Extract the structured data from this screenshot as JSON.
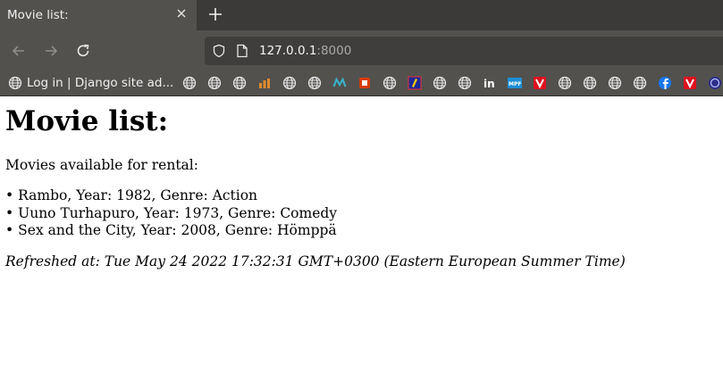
{
  "tab": {
    "title": "Movie list:"
  },
  "url": {
    "host": "127.0.0.1",
    "port": ":8000"
  },
  "bookmarks": {
    "first_label": "Log in | Django site ad...",
    "icons": [
      "globe-icon",
      "globe-icon",
      "globe-icon",
      "bars-icon",
      "globe-icon",
      "globe-icon",
      "m-logo-icon",
      "office-icon",
      "globe-icon",
      "blue-square-icon",
      "globe-icon",
      "globe-icon",
      "linkedin-icon",
      "mpf-icon",
      "v-red-icon",
      "globe-icon",
      "globe-icon",
      "globe-icon",
      "globe-icon",
      "facebook-icon",
      "v-red-icon",
      "circle-logo-icon",
      "partial-icon"
    ]
  },
  "page": {
    "title": "Movie list:",
    "intro": "Movies available for rental:",
    "movies": [
      "Rambo, Year: 1982, Genre: Action",
      "Uuno Turhapuro, Year: 1973, Genre: Comedy",
      "Sex and the City, Year: 2008, Genre: Hömppä"
    ],
    "refreshed": "Refreshed at: Tue May 24 2022 17:32:31 GMT+0300 (Eastern European Summer Time)"
  },
  "colors": {
    "chrome": "#52514e",
    "tabstrip": "#3b3a38",
    "urlbar": "#3f3e3c"
  }
}
